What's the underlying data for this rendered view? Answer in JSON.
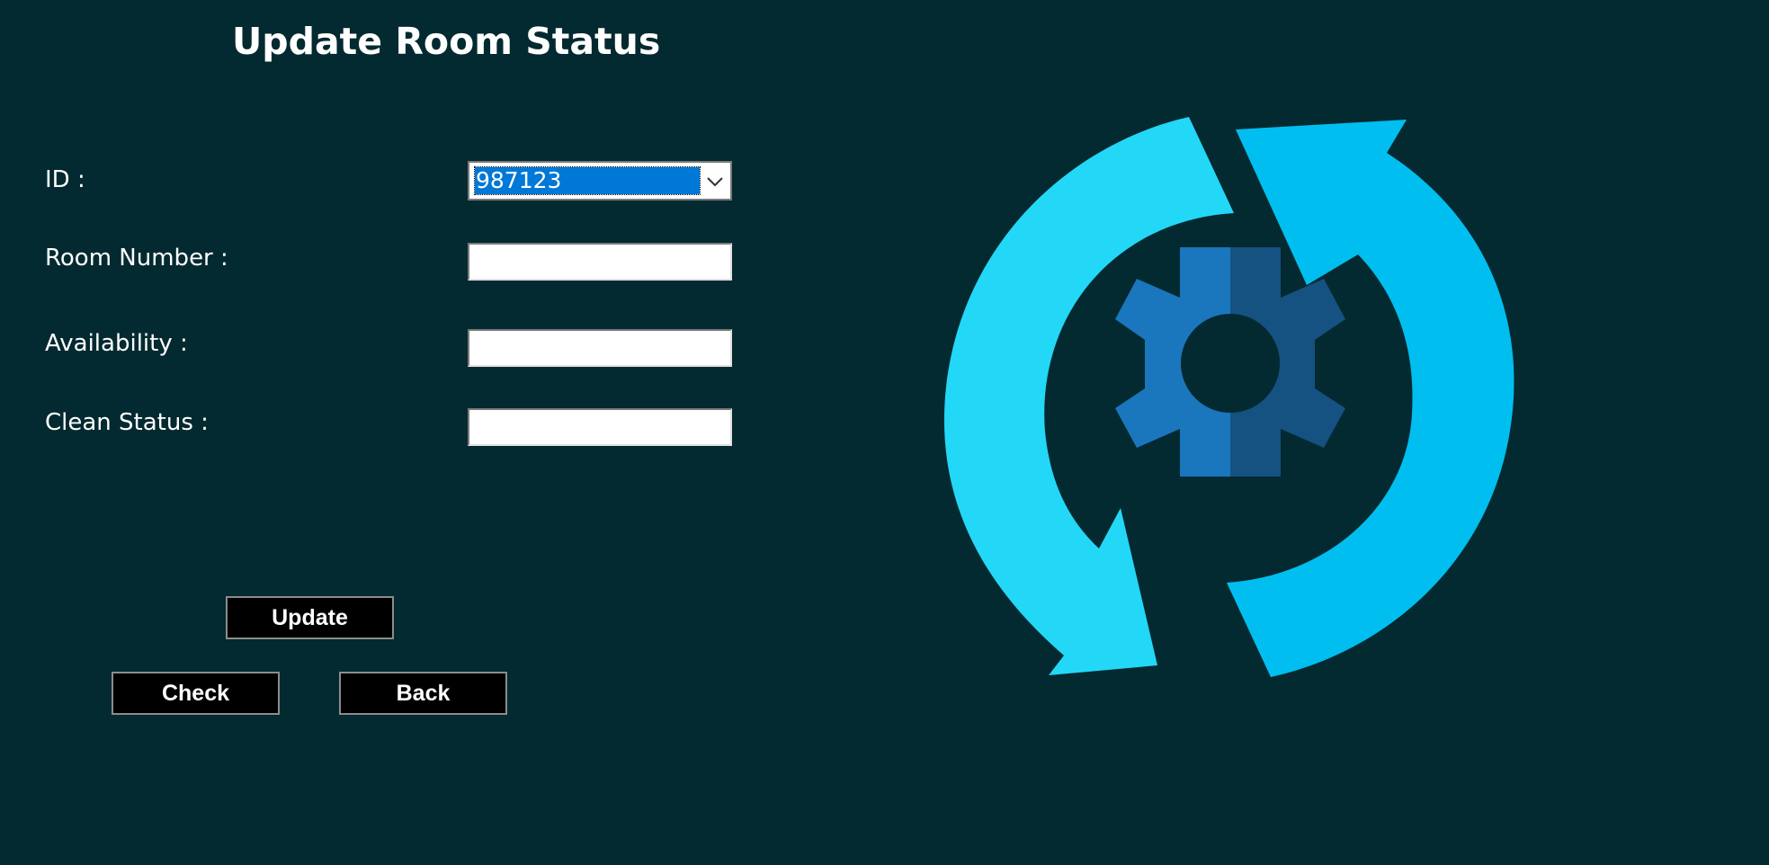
{
  "form": {
    "title": "Update Room Status",
    "id_label": "ID :",
    "id_value": "987123",
    "room_number_label": "Room Number :",
    "room_number_value": "",
    "availability_label": "Availability :",
    "availability_value": "",
    "clean_status_label": "Clean Status :",
    "clean_status_value": ""
  },
  "buttons": {
    "update": "Update",
    "check": "Check",
    "back": "Back"
  },
  "colors": {
    "background": "#032a30",
    "arrow_light": "#23d7f7",
    "arrow_mid": "#00bff0",
    "gear_light": "#1a76bd",
    "gear_dark": "#155181"
  },
  "icons": {
    "main_graphic": "refresh-gear-icon",
    "dropdown": "chevron-down-icon"
  }
}
